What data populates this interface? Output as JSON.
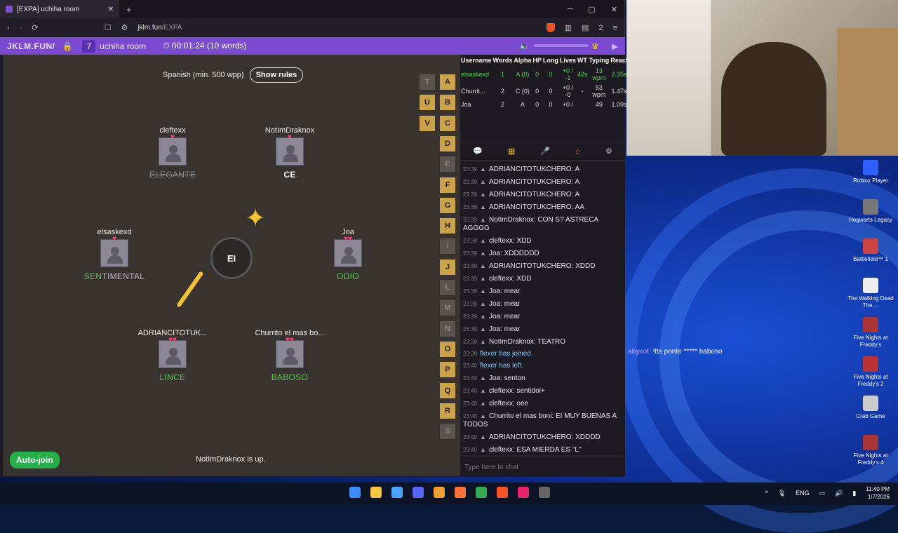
{
  "browser": {
    "tab_title": "[EXPA] uchiha room",
    "tab_close": "✕",
    "new_tab": "+",
    "url_host": "jklm.fun",
    "url_path": "/EXPA",
    "win_min": "─",
    "win_max": "▢",
    "win_close": "✕",
    "ext_count": "2"
  },
  "gamebar": {
    "brand": "JKLM.FUN/",
    "player_count": "7",
    "room": "uchiha room",
    "timer": "00:01:24 (10 words)"
  },
  "game": {
    "language": "Spanish (min. 500 wpp)",
    "show_rules": "Show rules",
    "syllable": "EI",
    "players": [
      {
        "name": "cleftexx",
        "hearts": "♥",
        "word_hl": "",
        "word_rest": "ELEGANTE",
        "struck": true
      },
      {
        "name": "NotImDraknox",
        "hearts": "♥",
        "word_hl": "",
        "word_rest": "CE",
        "struck": false
      },
      {
        "name": "elsaskexd",
        "hearts": "♥",
        "word_hl": "SEN",
        "word_rest": "TIMENTAL",
        "struck": false
      },
      {
        "name": "Joa",
        "hearts": "♥♥",
        "word_hl": "",
        "word_rest": "ODIO",
        "struck": false
      },
      {
        "name": "ADRIANCITOTUK...",
        "hearts": "♥♥",
        "word_hl": "",
        "word_rest": "LINCE",
        "struck": false
      },
      {
        "name": "Churrito el mas bo...",
        "hearts": "♥♥",
        "word_hl": "",
        "word_rest": "BABOSO",
        "struck": false
      }
    ],
    "letters_left": [
      "T",
      "U",
      "V"
    ],
    "letters_right": [
      "A",
      "B",
      "C",
      "D",
      "E",
      "F",
      "G",
      "H",
      "I",
      "J",
      "L",
      "M",
      "N",
      "O",
      "P",
      "Q",
      "R",
      "S"
    ],
    "auto_join": "Auto-join",
    "status": "NotImDraknox is up."
  },
  "stats": {
    "headers": [
      "Username",
      "Words",
      "Alpha",
      "HP",
      "Long",
      "Lives",
      "WT",
      "Typing",
      "React"
    ],
    "rows": [
      {
        "user": "elsaskexd",
        "words": "1",
        "alpha": "A (0)",
        "hp": "0",
        "long": "0",
        "lives": "+0 / -1",
        "wt": "42s",
        "typing": "13 wpm",
        "react": "2.35s"
      },
      {
        "user": "Churrit...",
        "words": "2",
        "alpha": "C (0)",
        "hp": "0",
        "long": "0",
        "lives": "+0 / -0",
        "wt": "-",
        "typing": "53 wpm",
        "react": "1.47s"
      },
      {
        "user": "Joa",
        "words": "2",
        "alpha": "A",
        "hp": "0",
        "long": "0",
        "lives": "+0 /",
        "wt": "",
        "typing": "49",
        "react": "1.09s"
      }
    ]
  },
  "chat": {
    "messages": [
      {
        "time": "23:39",
        "user": "ADRIANCITOTUKCHERO",
        "text": "A"
      },
      {
        "time": "23:39",
        "user": "ADRIANCITOTUKCHERO",
        "text": "A"
      },
      {
        "time": "23:39",
        "user": "ADRIANCITOTUKCHERO",
        "text": "A"
      },
      {
        "time": "23:39",
        "user": "ADRIANCITOTUKCHERO",
        "text": "AA"
      },
      {
        "time": "23:39",
        "user": "NotImDraknox",
        "text": "CON S? ASTRECA AGGGG"
      },
      {
        "time": "23:39",
        "user": "cleftexx",
        "text": "XDD"
      },
      {
        "time": "23:39",
        "user": "Joa",
        "text": "XDDDDDD"
      },
      {
        "time": "23:39",
        "user": "ADRIANCITOTUKCHERO",
        "text": "XDDD"
      },
      {
        "time": "23:39",
        "user": "cleftexx",
        "text": "XDD"
      },
      {
        "time": "23:39",
        "user": "Joa",
        "text": "mear"
      },
      {
        "time": "23:39",
        "user": "Joa",
        "text": "mear"
      },
      {
        "time": "23:39",
        "user": "Joa",
        "text": "mear"
      },
      {
        "time": "23:39",
        "user": "Joa",
        "text": "mear"
      },
      {
        "time": "23:39",
        "user": "NotImDraknox",
        "text": "TEATRO"
      },
      {
        "time": "23:39",
        "user": "",
        "text": "flexer has joined."
      },
      {
        "time": "23:40",
        "user": "",
        "text": "flexer has left."
      },
      {
        "time": "23:40",
        "user": "Joa",
        "text": "senton"
      },
      {
        "time": "23:40",
        "user": "cleftexx",
        "text": "sentidoi+"
      },
      {
        "time": "23:40",
        "user": "cleftexx",
        "text": "oee"
      },
      {
        "time": "23:40",
        "user": "Churrito el mas boni",
        "text": "EI MUY BUENAS A TODOS"
      },
      {
        "time": "23:40",
        "user": "ADRIANCITOTUKCHERO",
        "text": "XDDDD"
      },
      {
        "time": "23:40",
        "user": "cleftexx",
        "text": "ESA MIERDA ES \"L\""
      }
    ],
    "placeholder": "Type here to chat"
  },
  "desktop": {
    "icons": [
      "Roblox Player",
      "Hogwarts Legacy",
      "Battlefield™ 1",
      "The Walking Dead The ...",
      "Five Nights at Freddy's",
      "Five Nights at Freddy's 2",
      "Crab Game",
      "Five Nights at Freddy's 4"
    ],
    "twitch_user": "abyoX",
    "twitch_msg": ": !tts ponte ***** baboso"
  },
  "taskbar": {
    "lang": "ENG",
    "time": "11:40 PM",
    "date": "1/7/2026"
  }
}
